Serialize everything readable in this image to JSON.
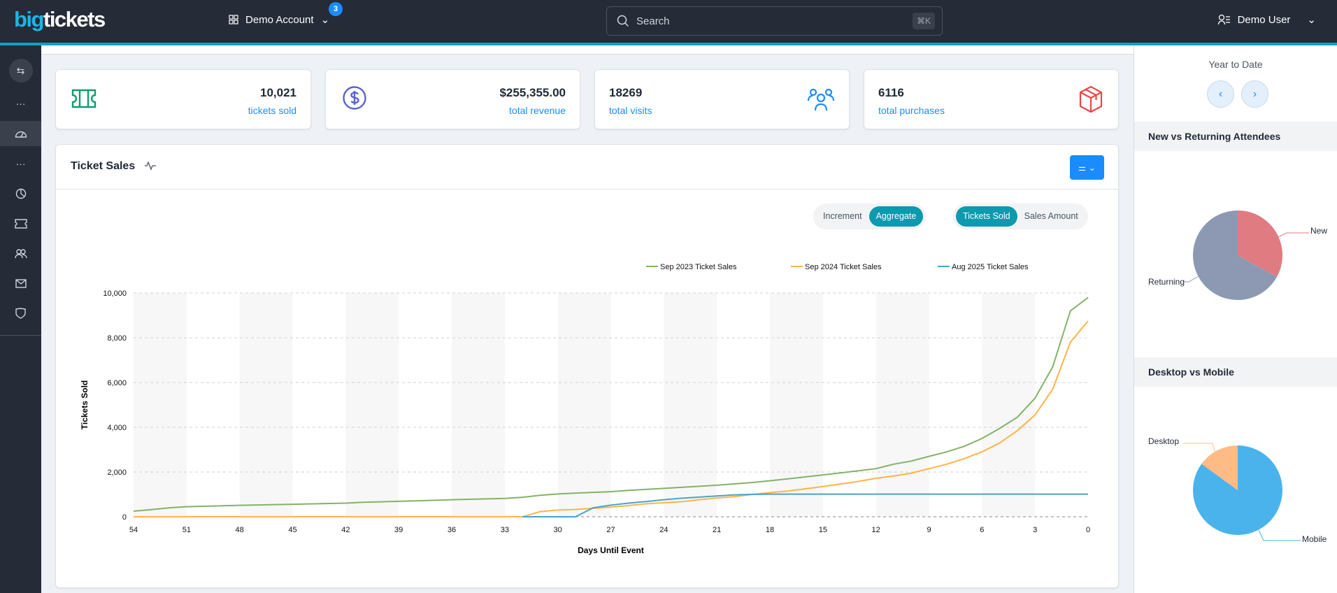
{
  "header": {
    "logo_big": "big",
    "logo_tickets": "tickets",
    "account": "Demo Account",
    "notification_count": "3",
    "search_placeholder": "Search",
    "search_shortcut": "⌘K",
    "user": "Demo User"
  },
  "sidebar": {
    "items": [
      "swap-icon",
      "more-icon",
      "dashboard-icon",
      "more-icon",
      "chart-pie-icon",
      "ticket-icon",
      "users-icon",
      "mail-icon",
      "shield-icon"
    ]
  },
  "stats": [
    {
      "value": "10,021",
      "label": "tickets sold",
      "icon": "ticket-icon",
      "color": "#0f9d6b"
    },
    {
      "value": "$255,355.00",
      "label": "total revenue",
      "icon": "dollar-icon",
      "color": "#5b63c9"
    },
    {
      "value": "18269",
      "label": "total visits",
      "icon": "users-icon",
      "color": "#1a8cff"
    },
    {
      "value": "6116",
      "label": "total purchases",
      "icon": "box-icon",
      "color": "#ef4444"
    }
  ],
  "ticket_sales": {
    "title": "Ticket Sales",
    "mode_toggle": [
      "Increment",
      "Aggregate"
    ],
    "mode_selected": "Aggregate",
    "metric_toggle": [
      "Tickets Sold",
      "Sales Amount"
    ],
    "metric_selected": "Tickets Sold"
  },
  "chart_data": {
    "type": "line",
    "xlabel": "Days Until Event",
    "ylabel": "Tickets Sold",
    "xlim": [
      54,
      0
    ],
    "ylim": [
      0,
      10000
    ],
    "xticks": [
      54,
      51,
      48,
      45,
      42,
      39,
      36,
      33,
      30,
      27,
      24,
      21,
      18,
      15,
      12,
      9,
      6,
      3,
      0
    ],
    "yticks": [
      "0",
      "2,000",
      "4,000",
      "6,000",
      "8,000",
      "10,000"
    ],
    "grid": true,
    "legend": "top",
    "series": [
      {
        "name": "Sep 2023 Ticket Sales",
        "color": "#82b366",
        "points": [
          [
            54,
            250
          ],
          [
            53,
            320
          ],
          [
            52,
            400
          ],
          [
            51,
            450
          ],
          [
            48,
            510
          ],
          [
            45,
            560
          ],
          [
            42,
            610
          ],
          [
            41,
            650
          ],
          [
            39,
            690
          ],
          [
            36,
            760
          ],
          [
            33,
            820
          ],
          [
            32,
            870
          ],
          [
            31,
            960
          ],
          [
            30,
            1020
          ],
          [
            29,
            1060
          ],
          [
            27,
            1120
          ],
          [
            26,
            1180
          ],
          [
            24,
            1270
          ],
          [
            21,
            1410
          ],
          [
            19,
            1530
          ],
          [
            18,
            1610
          ],
          [
            16,
            1780
          ],
          [
            15,
            1870
          ],
          [
            14,
            1960
          ],
          [
            12,
            2150
          ],
          [
            11,
            2350
          ],
          [
            10,
            2490
          ],
          [
            9,
            2700
          ],
          [
            8,
            2900
          ],
          [
            7,
            3150
          ],
          [
            6,
            3500
          ],
          [
            5,
            3950
          ],
          [
            4,
            4450
          ],
          [
            3,
            5300
          ],
          [
            2,
            6700
          ],
          [
            1,
            9200
          ],
          [
            0,
            9800
          ]
        ]
      },
      {
        "name": "Sep 2024 Ticket Sales",
        "color": "#ffb347",
        "points": [
          [
            54,
            0
          ],
          [
            32,
            0
          ],
          [
            31,
            230
          ],
          [
            30,
            300
          ],
          [
            29,
            330
          ],
          [
            28,
            380
          ],
          [
            27,
            430
          ],
          [
            26,
            500
          ],
          [
            25,
            580
          ],
          [
            24,
            630
          ],
          [
            23,
            670
          ],
          [
            22,
            760
          ],
          [
            21,
            840
          ],
          [
            20,
            900
          ],
          [
            19,
            1000
          ],
          [
            18,
            1080
          ],
          [
            17,
            1150
          ],
          [
            16,
            1250
          ],
          [
            15,
            1350
          ],
          [
            14,
            1460
          ],
          [
            13,
            1580
          ],
          [
            12,
            1720
          ],
          [
            11,
            1820
          ],
          [
            10,
            1950
          ],
          [
            9,
            2150
          ],
          [
            8,
            2350
          ],
          [
            7,
            2600
          ],
          [
            6,
            2900
          ],
          [
            5,
            3300
          ],
          [
            4,
            3850
          ],
          [
            3,
            4550
          ],
          [
            2,
            5700
          ],
          [
            1,
            7800
          ],
          [
            0,
            8750
          ]
        ]
      },
      {
        "name": "Aug 2025 Ticket Sales",
        "color": "#4aa3c7",
        "points": [
          [
            32,
            0
          ],
          [
            29,
            0
          ],
          [
            28,
            400
          ],
          [
            27,
            520
          ],
          [
            26,
            610
          ],
          [
            25,
            680
          ],
          [
            24,
            760
          ],
          [
            23,
            830
          ],
          [
            22,
            880
          ],
          [
            21,
            930
          ],
          [
            20,
            980
          ],
          [
            19,
            1000
          ],
          [
            18,
            1010
          ],
          [
            0,
            1010
          ]
        ]
      }
    ]
  },
  "right_panel": {
    "period": "Year to Date",
    "prev": "‹",
    "next": "›",
    "new_vs_returning": {
      "title": "New vs Returning Attendees",
      "slices": [
        {
          "label": "New",
          "value": 33,
          "color": "#e07b82"
        },
        {
          "label": "Returning",
          "value": 67,
          "color": "#8d99b3"
        }
      ]
    },
    "desktop_vs_mobile": {
      "title": "Desktop vs Mobile",
      "slices": [
        {
          "label": "Mobile",
          "value": 85,
          "color": "#4ab3ec"
        },
        {
          "label": "Desktop",
          "value": 15,
          "color": "#ffbb85"
        }
      ]
    }
  }
}
